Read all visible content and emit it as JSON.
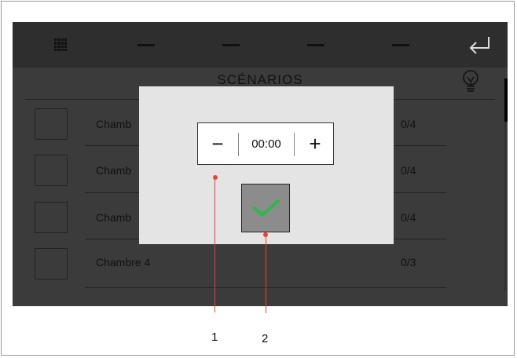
{
  "header": {
    "back_icon": "return-arrow-icon",
    "menu_icon": "grid-menu-icon"
  },
  "screen": {
    "title": "SCÉNARIOS",
    "light_icon": "lightbulb-icon"
  },
  "rows": [
    {
      "name": "Chamb",
      "count": "0/4"
    },
    {
      "name": "Chamb",
      "count": "0/4"
    },
    {
      "name": "Chamb",
      "count": "0/4"
    },
    {
      "name": "Chambre 4",
      "count": "0/3"
    }
  ],
  "dialog": {
    "minus_label": "−",
    "time_value": "00:00",
    "plus_label": "+",
    "confirm_icon": "checkmark-icon",
    "accent_color": "#2db84b"
  },
  "callouts": {
    "one": "1",
    "two": "2",
    "color": "#e0453a"
  }
}
